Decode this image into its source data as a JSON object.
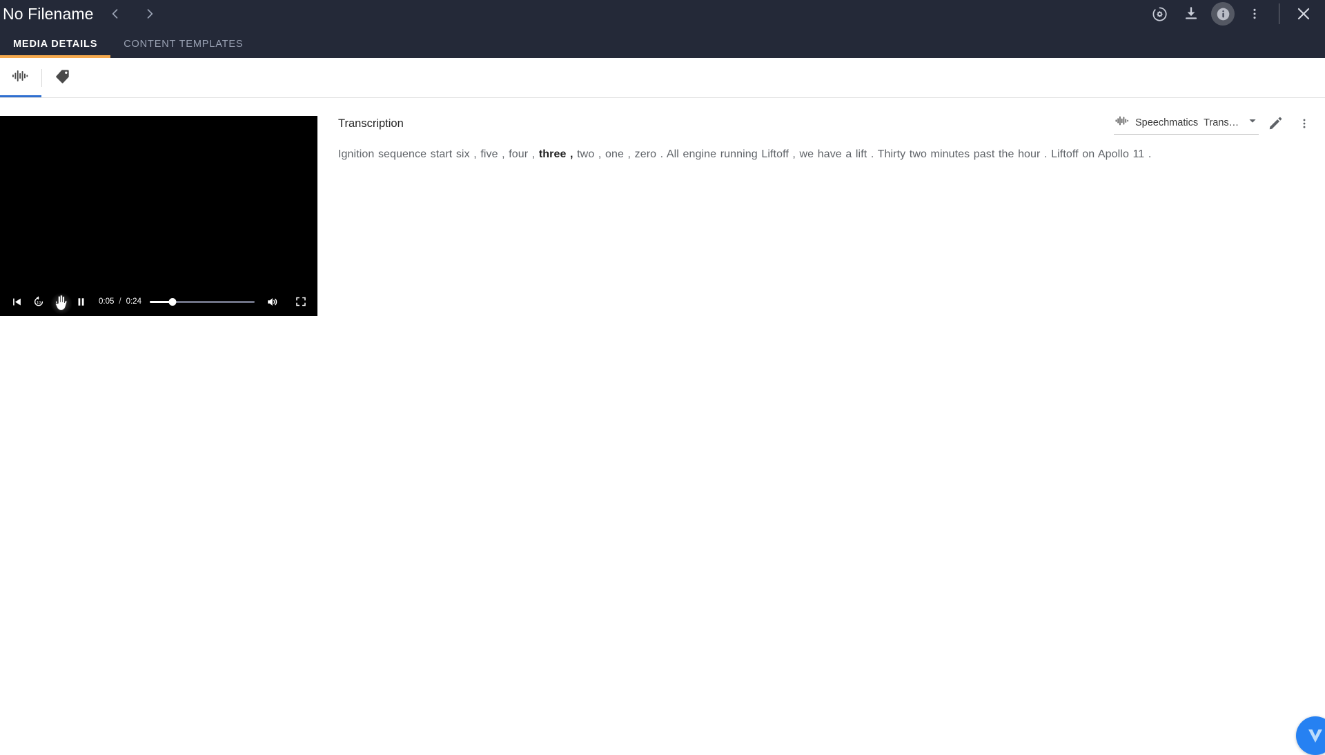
{
  "header": {
    "title": "No Filename",
    "nav": {
      "prev_icon": "chevron-left-icon",
      "next_icon": "chevron-right-icon"
    },
    "actions": [
      {
        "name": "settings-gear-icon",
        "label": "Settings"
      },
      {
        "name": "download-icon",
        "label": "Download"
      },
      {
        "name": "info-icon",
        "label": "Info",
        "active": true
      },
      {
        "name": "more-vertical-icon",
        "label": "More options"
      },
      {
        "name": "close-icon",
        "label": "Close"
      }
    ],
    "tabs": [
      {
        "label": "MEDIA DETAILS",
        "active": true
      },
      {
        "label": "CONTENT TEMPLATES",
        "active": false
      }
    ],
    "accent_active_tab": "#f5a94e",
    "background": "#242938"
  },
  "sub_toolbar": {
    "tabs": [
      {
        "name": "waveform-tab",
        "icon": "waveform-icon",
        "active": true
      },
      {
        "name": "tag-tab",
        "icon": "tag-icon",
        "active": false
      }
    ],
    "accent": "#2f6fd0"
  },
  "player": {
    "current_time": "0:05",
    "duration": "0:24",
    "separator": "/",
    "progress_percent": 22,
    "playing": true,
    "controls": [
      {
        "name": "skip-previous-button",
        "icon": "skip-previous-icon"
      },
      {
        "name": "replay-10-button",
        "icon": "replay-10-icon",
        "label": "10"
      },
      {
        "name": "forward-30-button",
        "icon": "forward-30-icon",
        "label": "30"
      },
      {
        "name": "play-pause-button",
        "icon": "pause-icon"
      }
    ],
    "right_controls": [
      {
        "name": "volume-button",
        "icon": "volume-up-icon"
      },
      {
        "name": "fullscreen-button",
        "icon": "fullscreen-icon"
      }
    ]
  },
  "transcription": {
    "title": "Transcription",
    "engine": {
      "icon": "waveform-icon",
      "vendor": "Speechmatics",
      "type": "Trans…",
      "dropdown_icon": "chevron-down-icon"
    },
    "edit_icon": "pencil-icon",
    "more_icon": "more-vertical-icon",
    "text_before": "Ignition sequence start six , five , four , ",
    "text_highlight": "three ,",
    "text_after": " two , one , zero . All engine running Liftoff , we have a lift . Thirty two minutes past the hour . Liftoff on Apollo 11 ."
  },
  "corner_badge": {
    "name": "veritone-logo-badge",
    "color": "#2681f2",
    "glyph": "V"
  }
}
